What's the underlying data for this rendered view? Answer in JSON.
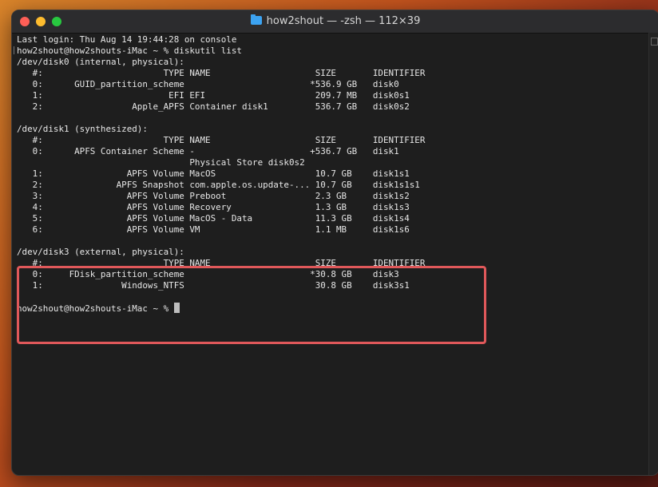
{
  "window": {
    "title": "how2shout — -zsh — 112×39",
    "folder_icon": "folder-icon"
  },
  "terminal": {
    "lines": [
      "Last login: Thu Aug 14 19:44:28 on console",
      "how2shout@how2shouts-iMac ~ % diskutil list",
      "/dev/disk0 (internal, physical):",
      "   #:                       TYPE NAME                    SIZE       IDENTIFIER",
      "   0:      GUID_partition_scheme                        *536.9 GB   disk0",
      "   1:                        EFI EFI                     209.7 MB   disk0s1",
      "   2:                 Apple_APFS Container disk1         536.7 GB   disk0s2",
      "",
      "/dev/disk1 (synthesized):",
      "   #:                       TYPE NAME                    SIZE       IDENTIFIER",
      "   0:      APFS Container Scheme -                      +536.7 GB   disk1",
      "                                 Physical Store disk0s2",
      "   1:                APFS Volume MacOS                   10.7 GB    disk1s1",
      "   2:              APFS Snapshot com.apple.os.update-... 10.7 GB    disk1s1s1",
      "   3:                APFS Volume Preboot                 2.3 GB     disk1s2",
      "   4:                APFS Volume Recovery                1.3 GB     disk1s3",
      "   5:                APFS Volume MacOS - Data            11.3 GB    disk1s4",
      "   6:                APFS Volume VM                      1.1 MB     disk1s6",
      "",
      "/dev/disk3 (external, physical):",
      "   #:                       TYPE NAME                    SIZE       IDENTIFIER",
      "   0:     FDisk_partition_scheme                        *30.8 GB    disk3",
      "   1:               Windows_NTFS                         30.8 GB    disk3s1",
      ""
    ],
    "prompt": "how2shout@how2shouts-iMac ~ % "
  },
  "colors": {
    "highlight_border": "#e0585a",
    "terminal_bg": "#1e1e1e",
    "text": "#e6e6e6"
  }
}
